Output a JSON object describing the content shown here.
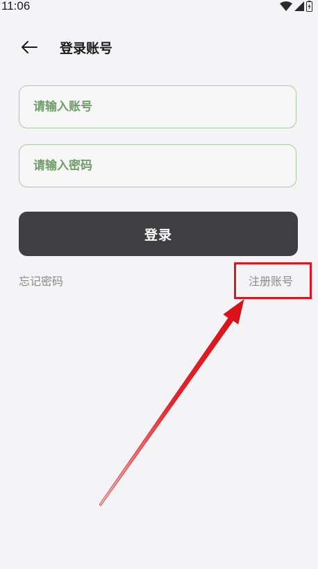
{
  "status_bar": {
    "time": "11:06",
    "icons": [
      "wifi-icon",
      "cellular-signal-icon",
      "battery-charging-icon"
    ]
  },
  "header": {
    "back_icon": "arrow-left-icon",
    "title": "登录账号"
  },
  "form": {
    "account_placeholder": "请输入账号",
    "password_placeholder": "请输入密码",
    "login_label": "登录"
  },
  "links": {
    "forgot_password": "忘记密码",
    "register": "注册账号"
  },
  "colors": {
    "background": "#f4f4f6",
    "field_border": "#a9c9a4",
    "placeholder": "#6e9e6a",
    "login_button": "#3f3f41",
    "link_text": "#8a8a8a",
    "annotation": "#e0141c"
  }
}
